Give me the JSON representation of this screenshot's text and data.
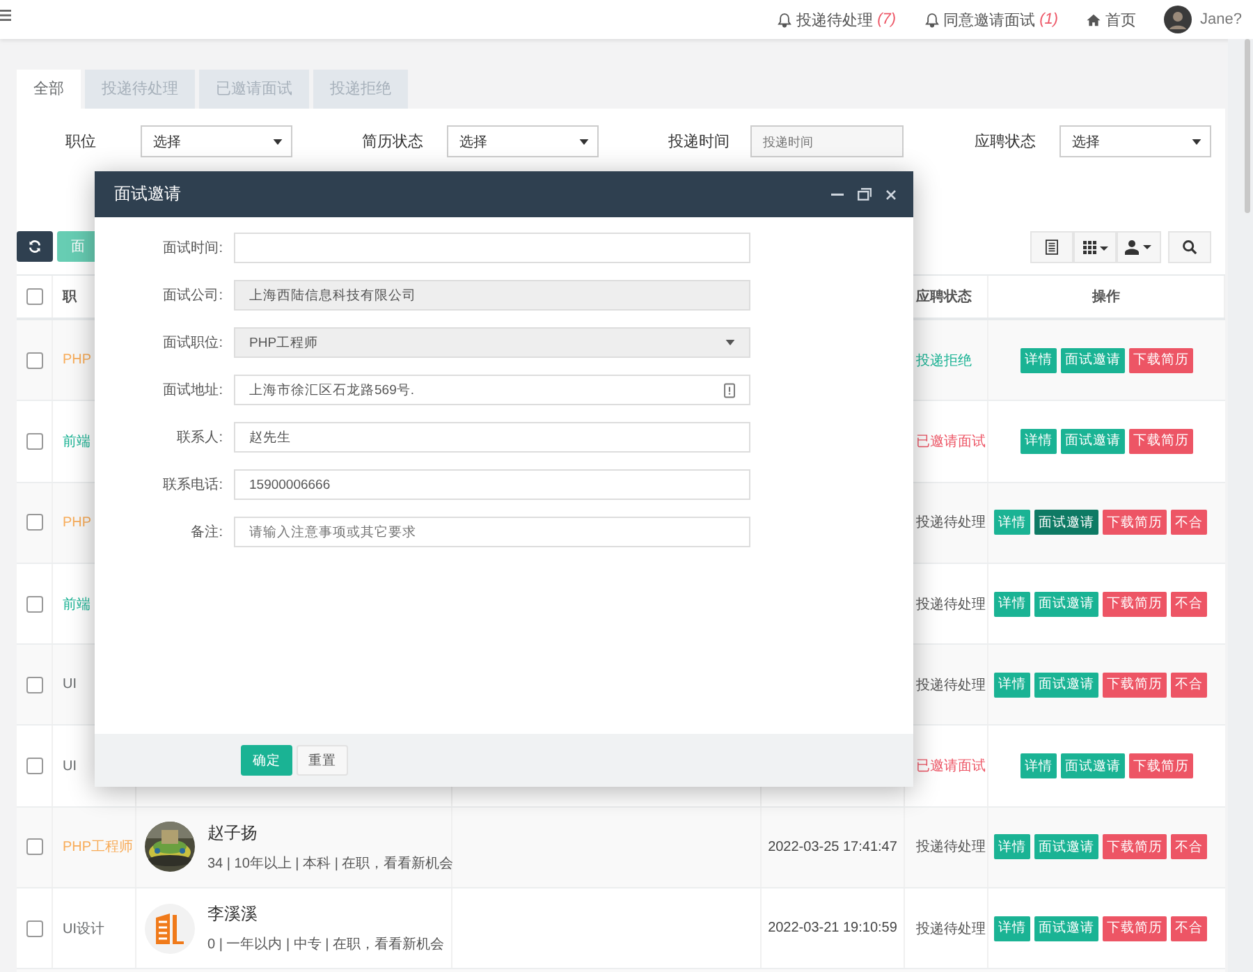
{
  "topbar": {
    "links": [
      {
        "kind": "notice",
        "label": "投递待处理",
        "count": "(7)"
      },
      {
        "kind": "notice",
        "label": "同意邀请面试",
        "count": "(1)"
      },
      {
        "kind": "home",
        "label": "首页"
      }
    ],
    "user": {
      "name": "Jane?"
    }
  },
  "tabs": [
    {
      "label": "全部",
      "selected": true
    },
    {
      "label": "投递待处理",
      "selected": false
    },
    {
      "label": "已邀请面试",
      "selected": false
    },
    {
      "label": "投递拒绝",
      "selected": false
    }
  ],
  "filters": [
    {
      "label": "职位",
      "kind": "select",
      "value": "选择"
    },
    {
      "label": "简历状态",
      "kind": "select",
      "value": "选择"
    },
    {
      "label": "投递时间",
      "kind": "date",
      "placeholder": "投递时间"
    },
    {
      "label": "应聘状态",
      "kind": "select",
      "value": "选择"
    }
  ],
  "toolbar": {
    "action_button": "面"
  },
  "table": {
    "select_all": {
      "checked": false
    },
    "columns": [
      {
        "label": "职"
      },
      {
        "label": "应聘状态"
      },
      {
        "label": "操作"
      }
    ],
    "rows": [
      {
        "checked": false,
        "job": {
          "text": "PHP",
          "color": "#f8ac59"
        },
        "status": {
          "text": "投递拒绝",
          "color": "#1ab394"
        },
        "actions": [
          {
            "label": "详情",
            "kind": "primary",
            "active": false
          },
          {
            "label": "面试邀请",
            "kind": "primary",
            "active": false
          },
          {
            "label": "下载简历",
            "kind": "danger",
            "active": false
          }
        ]
      },
      {
        "checked": false,
        "job": {
          "text": "前端",
          "color": "#1ab394"
        },
        "status": {
          "text": "已邀请面试",
          "color": "#ed5565"
        },
        "actions": [
          {
            "label": "详情",
            "kind": "primary",
            "active": false
          },
          {
            "label": "面试邀请",
            "kind": "primary",
            "active": false
          },
          {
            "label": "下载简历",
            "kind": "danger",
            "active": false
          }
        ]
      },
      {
        "checked": false,
        "job": {
          "text": "PHP",
          "color": "#f8ac59"
        },
        "status": {
          "text": "投递待处理",
          "color": "#555555"
        },
        "actions": [
          {
            "label": "详情",
            "kind": "primary",
            "active": false
          },
          {
            "label": "面试邀请",
            "kind": "primary",
            "active": true
          },
          {
            "label": "下载简历",
            "kind": "danger",
            "active": false
          },
          {
            "label": "不合",
            "kind": "danger",
            "active": false
          }
        ]
      },
      {
        "checked": false,
        "job": {
          "text": "前端",
          "color": "#1ab394"
        },
        "status": {
          "text": "投递待处理",
          "color": "#555555"
        },
        "actions": [
          {
            "label": "详情",
            "kind": "primary",
            "active": false
          },
          {
            "label": "面试邀请",
            "kind": "primary",
            "active": false
          },
          {
            "label": "下载简历",
            "kind": "danger",
            "active": false
          },
          {
            "label": "不合",
            "kind": "danger",
            "active": false
          }
        ]
      },
      {
        "checked": false,
        "job": {
          "text": "UI",
          "color": "#676a6c"
        },
        "status": {
          "text": "投递待处理",
          "color": "#555555"
        },
        "actions": [
          {
            "label": "详情",
            "kind": "primary",
            "active": false
          },
          {
            "label": "面试邀请",
            "kind": "primary",
            "active": false
          },
          {
            "label": "下载简历",
            "kind": "danger",
            "active": false
          },
          {
            "label": "不合",
            "kind": "danger",
            "active": false
          }
        ]
      },
      {
        "checked": false,
        "job": {
          "text": "UI",
          "color": "#676a6c"
        },
        "status": {
          "text": "已邀请面试",
          "color": "#ed5565"
        },
        "actions": [
          {
            "label": "详情",
            "kind": "primary",
            "active": false
          },
          {
            "label": "面试邀请",
            "kind": "primary",
            "active": false
          },
          {
            "label": "下载简历",
            "kind": "danger",
            "active": false
          }
        ]
      },
      {
        "checked": false,
        "job": {
          "text": "PHP工程师",
          "color": "#f8ac59"
        },
        "candidate": {
          "name": "赵子扬",
          "info": "34 | 10年以上 | 本科 | 在职，看看新机会"
        },
        "time": "2022-03-25 17:41:47",
        "status": {
          "text": "投递待处理",
          "color": "#555555"
        },
        "actions": [
          {
            "label": "详情",
            "kind": "primary",
            "active": false
          },
          {
            "label": "面试邀请",
            "kind": "primary",
            "active": false
          },
          {
            "label": "下载简历",
            "kind": "danger",
            "active": false
          },
          {
            "label": "不合",
            "kind": "danger",
            "active": false
          }
        ]
      },
      {
        "checked": false,
        "job": {
          "text": "UI设计",
          "color": "#676a6c"
        },
        "candidate": {
          "kind": "logo",
          "name": "李溪溪",
          "info": "0 | 一年以内 | 中专 | 在职，看看新机会"
        },
        "time": "2022-03-21 19:10:59",
        "status": {
          "text": "投递待处理",
          "color": "#555555"
        },
        "actions": [
          {
            "label": "详情",
            "kind": "primary",
            "active": false
          },
          {
            "label": "面试邀请",
            "kind": "primary",
            "active": false
          },
          {
            "label": "下载简历",
            "kind": "danger",
            "active": false
          },
          {
            "label": "不合",
            "kind": "danger",
            "active": false
          }
        ]
      }
    ]
  },
  "dialog": {
    "title": "面试邀请",
    "fields": [
      {
        "label": "面试时间:",
        "kind": "text"
      },
      {
        "label": "面试公司:",
        "kind": "readonly",
        "value": "上海西陆信息科技有限公司"
      },
      {
        "label": "面试职位:",
        "kind": "select",
        "value": "PHP工程师"
      },
      {
        "label": "面试地址:",
        "kind": "picker",
        "value": "上海市徐汇区石龙路569号."
      },
      {
        "label": "联系人:",
        "kind": "text",
        "value": "赵先生"
      },
      {
        "label": "联系电话:",
        "kind": "text",
        "value": "15900006666"
      },
      {
        "label": "备注:",
        "kind": "text",
        "placeholder": "请输入注意事项或其它要求"
      }
    ],
    "buttons": [
      {
        "label": "确定",
        "kind": "primary"
      },
      {
        "label": "重置",
        "kind": "default"
      }
    ]
  }
}
